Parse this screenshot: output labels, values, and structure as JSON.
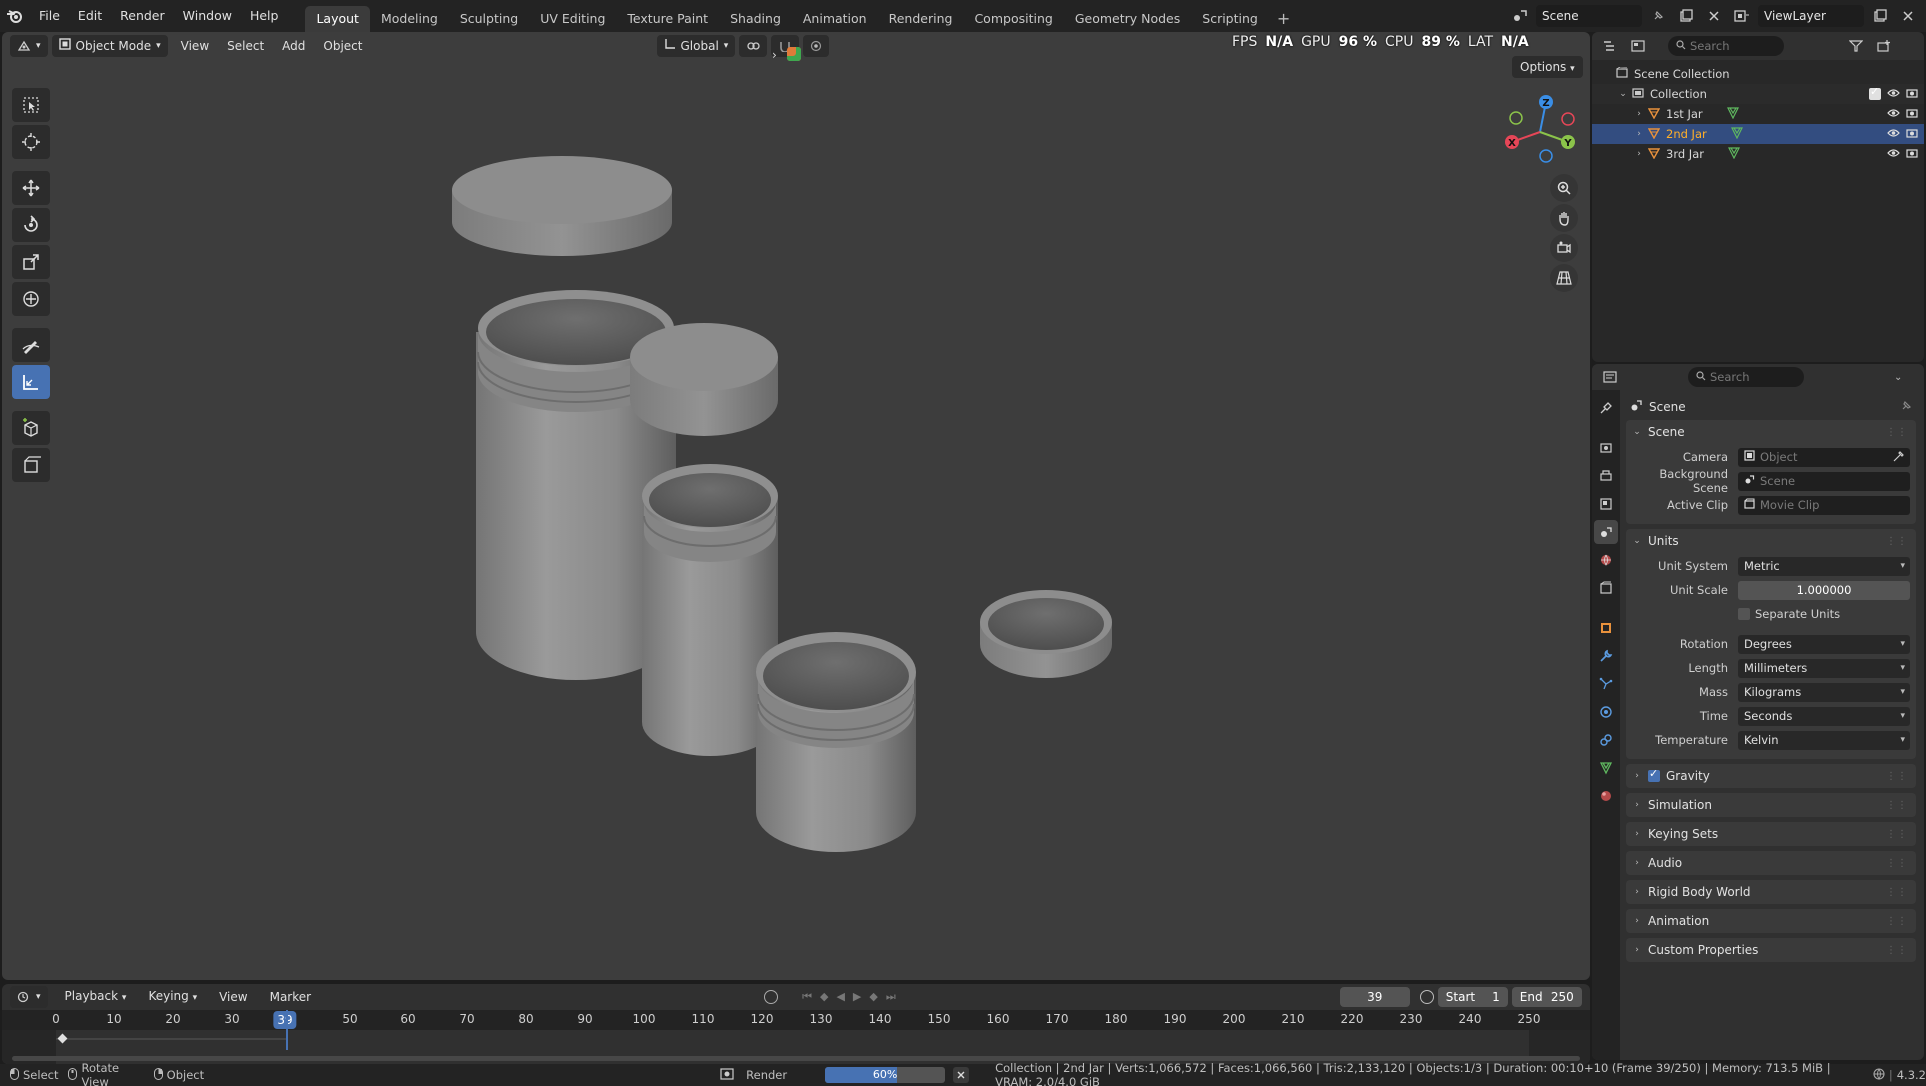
{
  "topbar": {
    "menus": [
      "File",
      "Edit",
      "Render",
      "Window",
      "Help"
    ],
    "workspaces": [
      "Layout",
      "Modeling",
      "Sculpting",
      "UV Editing",
      "Texture Paint",
      "Shading",
      "Animation",
      "Rendering",
      "Compositing",
      "Geometry Nodes",
      "Scripting"
    ],
    "active_workspace": "Layout",
    "scene_name": "Scene",
    "view_layer": "ViewLayer"
  },
  "viewport": {
    "mode": "Object Mode",
    "menus": [
      "View",
      "Select",
      "Add",
      "Object"
    ],
    "transform_orientation": "Global",
    "options_label": "Options",
    "stats": {
      "fps_label": "FPS",
      "fps_value": "N/A",
      "gpu_label": "GPU",
      "gpu_value": "96 %",
      "cpu_label": "CPU",
      "cpu_value": "89 %",
      "lat_label": "LAT",
      "lat_value": "N/A"
    },
    "gizmo_axes": [
      "X",
      "Y",
      "Z"
    ]
  },
  "timeline": {
    "menus": [
      "Playback",
      "Keying",
      "View",
      "Marker"
    ],
    "current_frame": "39",
    "start_label": "Start",
    "start_value": "1",
    "end_label": "End",
    "end_value": "250",
    "ticks": [
      "0",
      "10",
      "20",
      "30",
      "50",
      "60",
      "70",
      "80",
      "90",
      "100",
      "110",
      "120",
      "130",
      "140",
      "150",
      "160",
      "170",
      "180",
      "190",
      "200",
      "210",
      "220",
      "230",
      "240",
      "250"
    ]
  },
  "statusbar": {
    "select": "Select",
    "rotate": "Rotate View",
    "object": "Object",
    "render_label": "Render",
    "render_progress_text": "60%",
    "render_progress": 0.6,
    "info": "Collection | 2nd Jar | Verts:1,066,572 | Faces:1,066,560 | Tris:2,133,120 | Objects:1/3 | Duration: 00:10+10 (Frame 39/250) | Memory: 713.5 MiB | VRAM: 2.0/4.0 GiB",
    "version": "4.3.2"
  },
  "outliner": {
    "search_placeholder": "Search",
    "scene_collection": "Scene Collection",
    "collection": "Collection",
    "objects": [
      {
        "name": "1st Jar",
        "selected": false
      },
      {
        "name": "2nd Jar",
        "selected": true
      },
      {
        "name": "3rd Jar",
        "selected": false
      }
    ]
  },
  "properties": {
    "search_placeholder": "Search",
    "context": "Scene",
    "scene_panel": {
      "title": "Scene",
      "camera_label": "Camera",
      "camera_placeholder": "Object",
      "background_label": "Background Scene",
      "background_placeholder": "Scene",
      "clip_label": "Active Clip",
      "clip_placeholder": "Movie Clip"
    },
    "units_panel": {
      "title": "Units",
      "unit_system_label": "Unit System",
      "unit_system": "Metric",
      "unit_scale_label": "Unit Scale",
      "unit_scale": "1.000000",
      "separate_units": "Separate Units",
      "rotation_label": "Rotation",
      "rotation": "Degrees",
      "length_label": "Length",
      "length": "Millimeters",
      "mass_label": "Mass",
      "mass": "Kilograms",
      "time_label": "Time",
      "time": "Seconds",
      "temperature_label": "Temperature",
      "temperature": "Kelvin"
    },
    "collapsed_panels": [
      "Gravity",
      "Simulation",
      "Keying Sets",
      "Audio",
      "Rigid Body World",
      "Animation",
      "Custom Properties"
    ]
  },
  "colors": {
    "accent": "#4772b3",
    "selection_text": "#ffaf29",
    "axis_x": "#e64657",
    "axis_y": "#8bc34a",
    "axis_z": "#3a8ee6"
  }
}
